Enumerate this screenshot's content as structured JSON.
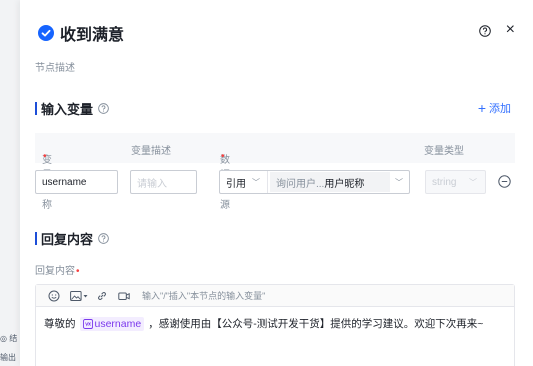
{
  "left_strip": {
    "items": [
      "◎ 结",
      "输出"
    ]
  },
  "header": {
    "title": "收到满意",
    "close_symbol": "×"
  },
  "node": {
    "description_placeholder": "节点描述"
  },
  "input_section": {
    "title": "输入变量",
    "add_label": "添加",
    "columns": [
      "变量名称",
      "变量描述",
      "数据来源",
      "变量类型"
    ],
    "row": {
      "name": "username",
      "desc_placeholder": "请输入",
      "source_type": "引用",
      "source_prefix": "询问用户...",
      "source_value": "用户昵称",
      "var_type": "string"
    }
  },
  "reply_section": {
    "title": "回复内容",
    "field_label": "回复内容",
    "toolbar_hint": "输入\"/\"插入\"本节点的输入变量\"",
    "content_prefix": "尊敬的",
    "variable": "username",
    "content_suffix": "，感谢使用由【公众号-测试开发干货】提供的学习建议。欢迎下次再来~"
  },
  "colors": {
    "accent": "#3370ff",
    "section_bar": "#1d4ed8",
    "required": "#f53f3f",
    "variable": "#7c3aed"
  }
}
